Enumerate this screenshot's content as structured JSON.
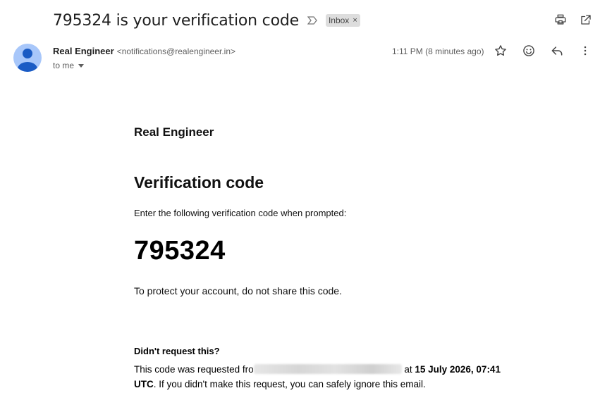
{
  "email": {
    "subject": "795324 is your verification code",
    "label": "Inbox",
    "label_remove": "×",
    "sender_name": "Real Engineer",
    "sender_email": "<notifications@realengineer.in>",
    "recipient": "to me",
    "time": "1:11 PM (8 minutes ago)"
  },
  "icons": {
    "important": "important-marker-icon",
    "print": "print-icon",
    "open_new_window": "open-in-new-icon",
    "star": "star-icon",
    "emoji": "emoji-icon",
    "reply": "reply-icon",
    "more": "more-vert-icon"
  },
  "body": {
    "brand": "Real Engineer",
    "heading": "Verification code",
    "instruction": "Enter the following verification code when prompted:",
    "code": "795324",
    "warning": "To protect your account, do not share this code.",
    "didnt_request": "Didn't request this?",
    "requested_prefix": "This code was requested fro",
    "requested_at": " at ",
    "requested_time": "15 July 2026, 07:41 UTC",
    "requested_suffix": ". If you didn't make this request, you can safely ignore this email."
  },
  "colors": {
    "avatar_bg": "#a8c7fa",
    "avatar_fg": "#1a5bc4",
    "label_chip_bg": "#dddddd"
  }
}
